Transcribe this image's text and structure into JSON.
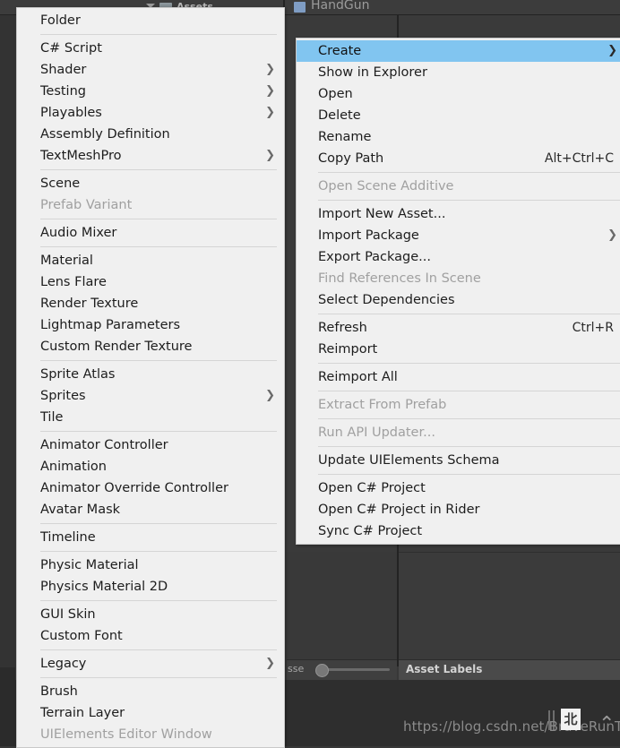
{
  "editor": {
    "breadcrumb_label": "Assets",
    "selected_asset_label": "HandGun",
    "preview_slider_label": "sse",
    "asset_labels_title": "Asset Labels",
    "watermark": "https://blog.csdn.net/BraveRunTo",
    "watermark_badge": "北",
    "watermark_caret": "⌃",
    "colors": {
      "editor_bg": "#383838",
      "menu_bg": "#f0f0f0",
      "menu_text": "#1d1d1d",
      "menu_disabled_text": "#a0a0a0",
      "highlight": "#81c5f0",
      "separator": "#d5d5d5"
    }
  },
  "create_menu": {
    "name": "Create",
    "groups": [
      {
        "items": [
          {
            "label": "Folder",
            "submenu": false,
            "disabled": false
          }
        ]
      },
      {
        "items": [
          {
            "label": "C# Script",
            "submenu": false,
            "disabled": false
          },
          {
            "label": "Shader",
            "submenu": true,
            "disabled": false
          },
          {
            "label": "Testing",
            "submenu": true,
            "disabled": false
          },
          {
            "label": "Playables",
            "submenu": true,
            "disabled": false
          },
          {
            "label": "Assembly Definition",
            "submenu": false,
            "disabled": false
          },
          {
            "label": "TextMeshPro",
            "submenu": true,
            "disabled": false
          }
        ]
      },
      {
        "items": [
          {
            "label": "Scene",
            "submenu": false,
            "disabled": false
          },
          {
            "label": "Prefab Variant",
            "submenu": false,
            "disabled": true
          }
        ]
      },
      {
        "items": [
          {
            "label": "Audio Mixer",
            "submenu": false,
            "disabled": false
          }
        ]
      },
      {
        "items": [
          {
            "label": "Material",
            "submenu": false,
            "disabled": false
          },
          {
            "label": "Lens Flare",
            "submenu": false,
            "disabled": false
          },
          {
            "label": "Render Texture",
            "submenu": false,
            "disabled": false
          },
          {
            "label": "Lightmap Parameters",
            "submenu": false,
            "disabled": false
          },
          {
            "label": "Custom Render Texture",
            "submenu": false,
            "disabled": false
          }
        ]
      },
      {
        "items": [
          {
            "label": "Sprite Atlas",
            "submenu": false,
            "disabled": false
          },
          {
            "label": "Sprites",
            "submenu": true,
            "disabled": false
          },
          {
            "label": "Tile",
            "submenu": false,
            "disabled": false
          }
        ]
      },
      {
        "items": [
          {
            "label": "Animator Controller",
            "submenu": false,
            "disabled": false
          },
          {
            "label": "Animation",
            "submenu": false,
            "disabled": false
          },
          {
            "label": "Animator Override Controller",
            "submenu": false,
            "disabled": false
          },
          {
            "label": "Avatar Mask",
            "submenu": false,
            "disabled": false
          }
        ]
      },
      {
        "items": [
          {
            "label": "Timeline",
            "submenu": false,
            "disabled": false
          }
        ]
      },
      {
        "items": [
          {
            "label": "Physic Material",
            "submenu": false,
            "disabled": false
          },
          {
            "label": "Physics Material 2D",
            "submenu": false,
            "disabled": false
          }
        ]
      },
      {
        "items": [
          {
            "label": "GUI Skin",
            "submenu": false,
            "disabled": false
          },
          {
            "label": "Custom Font",
            "submenu": false,
            "disabled": false
          }
        ]
      },
      {
        "items": [
          {
            "label": "Legacy",
            "submenu": true,
            "disabled": false
          }
        ]
      },
      {
        "items": [
          {
            "label": "Brush",
            "submenu": false,
            "disabled": false
          },
          {
            "label": "Terrain Layer",
            "submenu": false,
            "disabled": false
          },
          {
            "label": "UIElements Editor Window",
            "submenu": false,
            "disabled": true
          }
        ]
      }
    ]
  },
  "assets_menu": {
    "name": "Assets",
    "groups": [
      {
        "items": [
          {
            "label": "Create",
            "submenu": true,
            "disabled": false,
            "selected": true,
            "shortcut": ""
          },
          {
            "label": "Show in Explorer",
            "submenu": false,
            "disabled": false,
            "shortcut": ""
          },
          {
            "label": "Open",
            "submenu": false,
            "disabled": false,
            "shortcut": ""
          },
          {
            "label": "Delete",
            "submenu": false,
            "disabled": false,
            "shortcut": ""
          },
          {
            "label": "Rename",
            "submenu": false,
            "disabled": false,
            "shortcut": ""
          },
          {
            "label": "Copy Path",
            "submenu": false,
            "disabled": false,
            "shortcut": "Alt+Ctrl+C"
          }
        ]
      },
      {
        "items": [
          {
            "label": "Open Scene Additive",
            "submenu": false,
            "disabled": true,
            "shortcut": ""
          }
        ]
      },
      {
        "items": [
          {
            "label": "Import New Asset...",
            "submenu": false,
            "disabled": false,
            "shortcut": ""
          },
          {
            "label": "Import Package",
            "submenu": true,
            "disabled": false,
            "shortcut": ""
          },
          {
            "label": "Export Package...",
            "submenu": false,
            "disabled": false,
            "shortcut": ""
          },
          {
            "label": "Find References In Scene",
            "submenu": false,
            "disabled": true,
            "shortcut": ""
          },
          {
            "label": "Select Dependencies",
            "submenu": false,
            "disabled": false,
            "shortcut": ""
          }
        ]
      },
      {
        "items": [
          {
            "label": "Refresh",
            "submenu": false,
            "disabled": false,
            "shortcut": "Ctrl+R"
          },
          {
            "label": "Reimport",
            "submenu": false,
            "disabled": false,
            "shortcut": ""
          }
        ]
      },
      {
        "items": [
          {
            "label": "Reimport All",
            "submenu": false,
            "disabled": false,
            "shortcut": ""
          }
        ]
      },
      {
        "items": [
          {
            "label": "Extract From Prefab",
            "submenu": false,
            "disabled": true,
            "shortcut": ""
          }
        ]
      },
      {
        "items": [
          {
            "label": "Run API Updater...",
            "submenu": false,
            "disabled": true,
            "shortcut": ""
          }
        ]
      },
      {
        "items": [
          {
            "label": "Update UIElements Schema",
            "submenu": false,
            "disabled": false,
            "shortcut": ""
          }
        ]
      },
      {
        "items": [
          {
            "label": "Open C# Project",
            "submenu": false,
            "disabled": false,
            "shortcut": ""
          },
          {
            "label": "Open C# Project in Rider",
            "submenu": false,
            "disabled": false,
            "shortcut": ""
          },
          {
            "label": "Sync C# Project",
            "submenu": false,
            "disabled": false,
            "shortcut": ""
          }
        ]
      }
    ]
  }
}
